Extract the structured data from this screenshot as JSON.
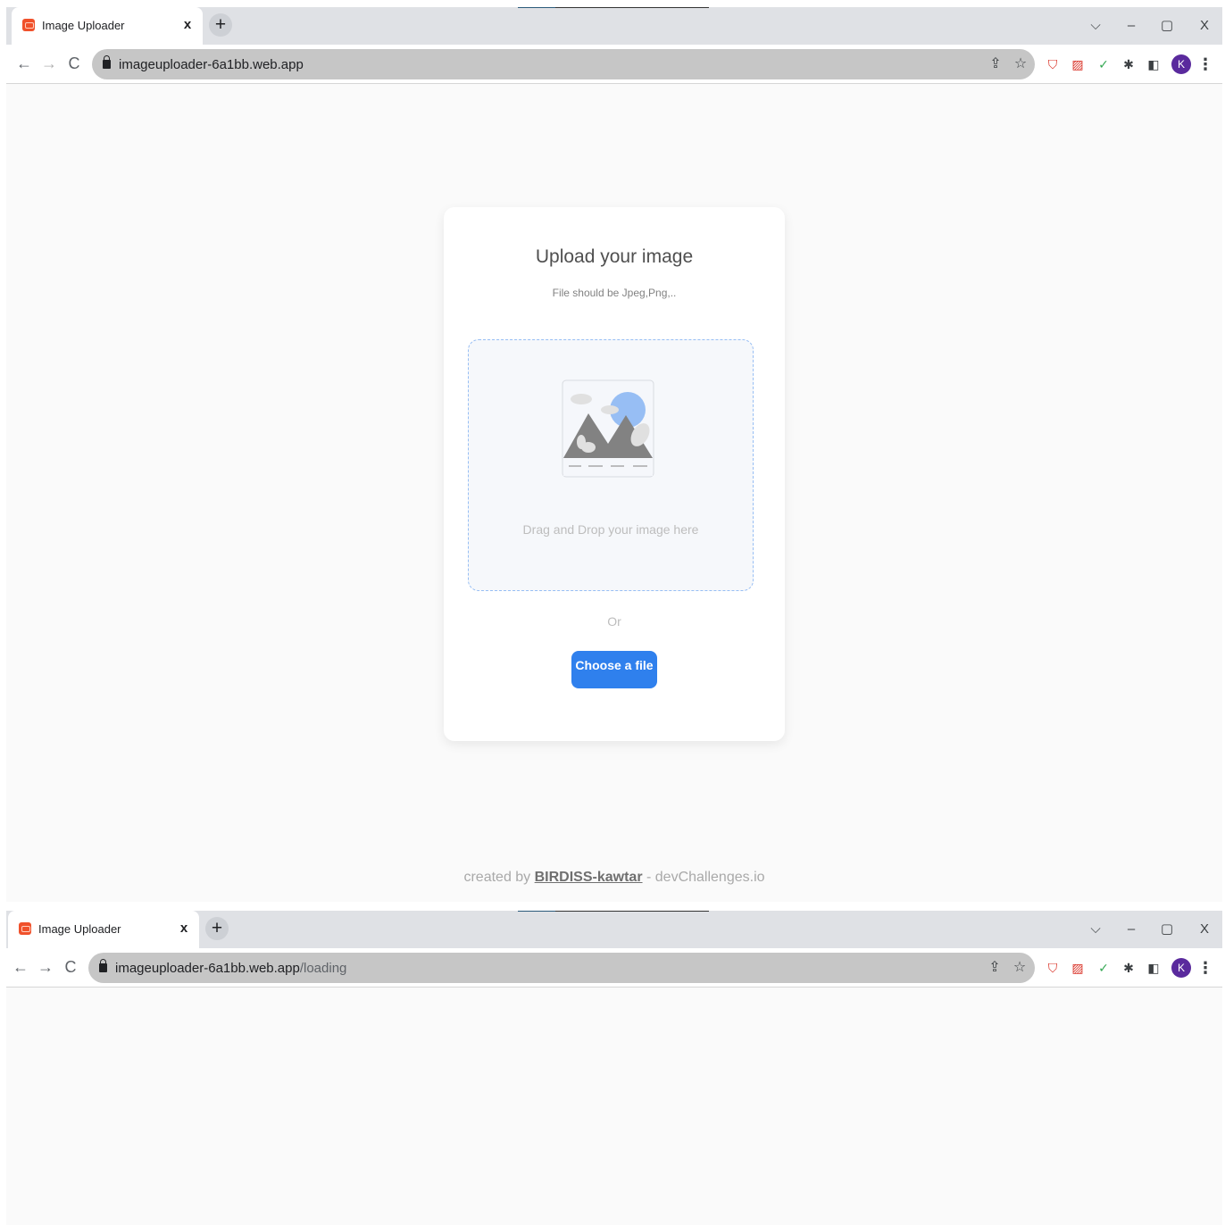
{
  "window1": {
    "tab": {
      "title": "Image Uploader",
      "close": "x"
    },
    "newtab": "+",
    "controls": {
      "dropdown": "⌵",
      "minimize": "–",
      "maximize": "▢",
      "close": "X"
    },
    "nav": {
      "back": "←",
      "forward": "→",
      "reload": "C"
    },
    "address": {
      "host": "imageuploader-6a1bb.web.app",
      "path": ""
    },
    "avatar": "K",
    "card": {
      "title": "Upload your image",
      "subtitle": "File should be Jpeg,Png,..",
      "drop_text": "Drag and Drop your image here",
      "or": "Or",
      "button": "Choose a file"
    },
    "footer": {
      "prefix": "created by ",
      "author": "BIRDISS-kawtar",
      "suffix": " - devChallenges.io"
    }
  },
  "window2": {
    "tab": {
      "title": "Image Uploader",
      "close": "x"
    },
    "newtab": "+",
    "controls": {
      "dropdown": "⌵",
      "minimize": "–",
      "maximize": "▢",
      "close": "X"
    },
    "nav": {
      "back": "←",
      "forward": "→",
      "reload": "C"
    },
    "address": {
      "host": "imageuploader-6a1bb.web.app",
      "path": "/loading"
    },
    "avatar": "K"
  },
  "icons": {
    "share": "share-icon",
    "bookmark": "star-icon",
    "extensions": [
      "shield-extension-icon",
      "image-extension-icon",
      "check-extension-icon",
      "puzzle-icon",
      "sidepanel-icon"
    ],
    "menu": "more-vert-icon"
  },
  "colors": {
    "accent": "#2f80ed",
    "dropzone_border": "#97bef4",
    "dropzone_bg": "#f6f8fb",
    "avatar": "#5a2a9d",
    "favicon": "#f0512b"
  }
}
